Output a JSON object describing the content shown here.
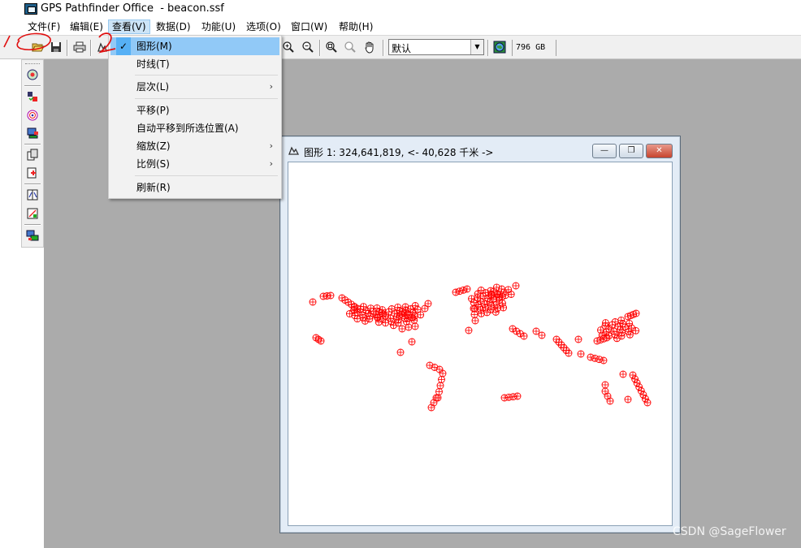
{
  "window": {
    "title": "GPS Pathfinder Office  - beacon.ssf"
  },
  "menubar": {
    "items": [
      {
        "label": "文件(F)"
      },
      {
        "label": "编辑(E)"
      },
      {
        "label": "查看(V)"
      },
      {
        "label": "数据(D)"
      },
      {
        "label": "功能(U)"
      },
      {
        "label": "选项(O)"
      },
      {
        "label": "窗口(W)"
      },
      {
        "label": "帮助(H)"
      }
    ]
  },
  "toolbar": {
    "layer_select_value": "默认",
    "disk_space": "796 GB"
  },
  "view_menu": {
    "items": [
      {
        "label": "图形(M)",
        "checked": true,
        "submenu": false
      },
      {
        "label": "时线(T)",
        "checked": false,
        "submenu": false
      },
      {
        "label": "层次(L)",
        "checked": false,
        "submenu": true
      },
      {
        "label": "平移(P)",
        "checked": false,
        "submenu": false
      },
      {
        "label": "自动平移到所选位置(A)",
        "checked": false,
        "submenu": false
      },
      {
        "label": "缩放(Z)",
        "checked": false,
        "submenu": true
      },
      {
        "label": "比例(S)",
        "checked": false,
        "submenu": true
      },
      {
        "label": "刷新(R)",
        "checked": false,
        "submenu": false
      }
    ],
    "check_glyph": "✓",
    "submenu_glyph": "›"
  },
  "map_window": {
    "title": "图形 1: 324,641,819, <- 40,628 千米 ->",
    "minimize_glyph": "—",
    "restore_glyph": "❐",
    "close_glyph": "✕",
    "point_color": "#ff0000",
    "marker": "circle-plus"
  },
  "watermark": "CSDN @SageFlower",
  "colors": {
    "menu_highlight": "#91c9f7",
    "mdi_background": "#ababab",
    "annotation": "#e01010"
  }
}
